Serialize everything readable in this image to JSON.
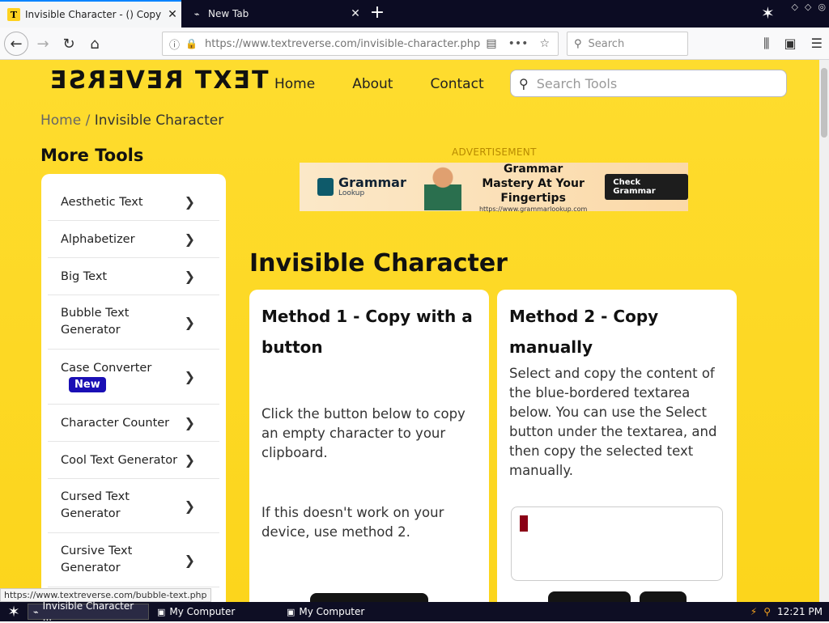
{
  "browser": {
    "tabs": [
      {
        "title": "Invisible Character - () Copy and P",
        "favicon": "T",
        "active": true
      },
      {
        "title": "New Tab",
        "active": false
      }
    ],
    "url": "https://www.textreverse.com/invisible-character.php",
    "search_placeholder": "Search",
    "status_url": "https://www.textreverse.com/bubble-text.php"
  },
  "site": {
    "logo": "TEXT REVERSE",
    "nav": [
      "Home",
      "About",
      "Contact"
    ],
    "search_placeholder": "Search Tools",
    "breadcrumb": {
      "home": "Home",
      "sep": " / ",
      "current": "Invisible Character"
    },
    "more_tools_title": "More Tools",
    "tools": [
      {
        "label": "Aesthetic Text"
      },
      {
        "label": "Alphabetizer"
      },
      {
        "label": "Big Text"
      },
      {
        "label": "Bubble Text Generator"
      },
      {
        "label": "Case Converter",
        "badge": "New"
      },
      {
        "label": "Character Counter"
      },
      {
        "label": "Cool Text Generator"
      },
      {
        "label": "Cursed Text Generator"
      },
      {
        "label": "Cursive Text Generator"
      }
    ],
    "ad": {
      "label": "ADVERTISEMENT",
      "brand": "Grammar",
      "brand_sub": "Lookup",
      "headline": "Grammar Mastery At Your Fingertips",
      "url": "https://www.grammarlookup.com",
      "cta": "Check Grammar"
    },
    "page_title": "Invisible Character",
    "method1": {
      "title": "Method 1 - Copy with a button",
      "p1": "Click the button below to copy an empty character to your clipboard.",
      "p2": "If this doesn't work on your device, use method 2."
    },
    "method2": {
      "title": "Method 2 - Copy manually",
      "p1": "Select and copy the content of the blue-bordered textarea below. You can use the Select button under the textarea, and then copy the selected text manually."
    }
  },
  "taskbar": {
    "items": [
      "Invisible Character ...",
      "My Computer",
      "My Computer"
    ],
    "clock": "12:21 PM"
  }
}
